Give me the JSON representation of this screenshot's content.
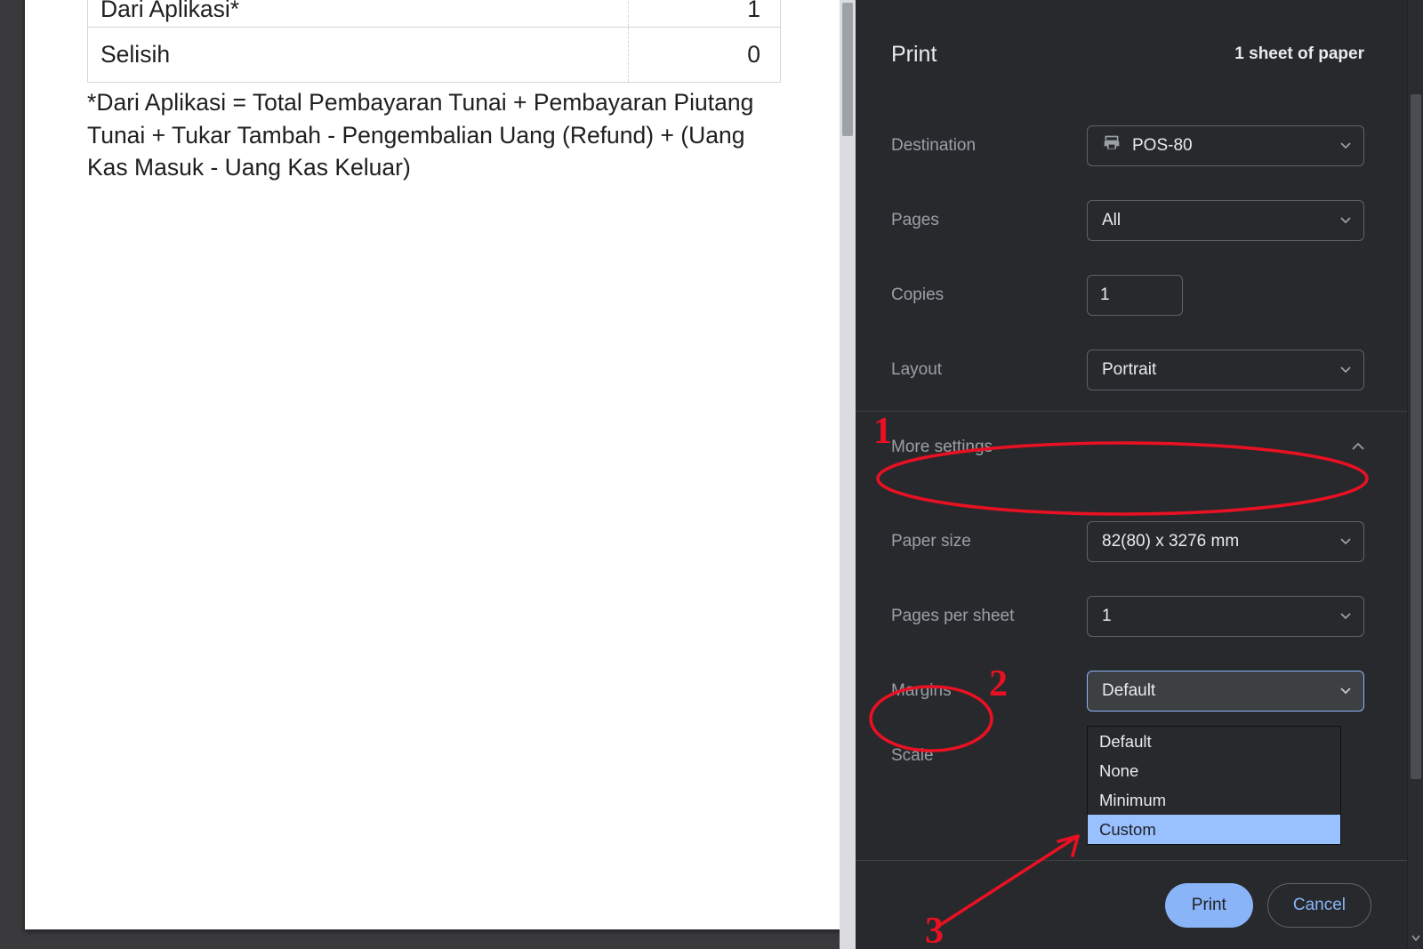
{
  "preview": {
    "rows": [
      {
        "label": "Dari Aplikasi*",
        "value": "1"
      },
      {
        "label": "Selisih",
        "value": "0"
      }
    ],
    "footnote": "*Dari Aplikasi = Total Pembayaran Tunai + Pembayaran Piutang Tunai + Tukar Tambah - Pengembalian Uang (Refund) + (Uang Kas Masuk - Uang Kas Keluar)"
  },
  "panel": {
    "title": "Print",
    "sheets": "1 sheet of paper",
    "destination_label": "Destination",
    "destination_value": "POS-80",
    "pages_label": "Pages",
    "pages_value": "All",
    "copies_label": "Copies",
    "copies_value": "1",
    "layout_label": "Layout",
    "layout_value": "Portrait",
    "more_settings_label": "More settings",
    "paper_label": "Paper size",
    "paper_value": "82(80) x 3276 mm",
    "pps_label": "Pages per sheet",
    "pps_value": "1",
    "margins_label": "Margins",
    "margins_value": "Default",
    "scale_label": "Scale",
    "print_button": "Print",
    "cancel_button": "Cancel",
    "margins_options": [
      "Default",
      "None",
      "Minimum",
      "Custom"
    ]
  },
  "annotations": {
    "n1": "1",
    "n2": "2",
    "n3": "3"
  }
}
